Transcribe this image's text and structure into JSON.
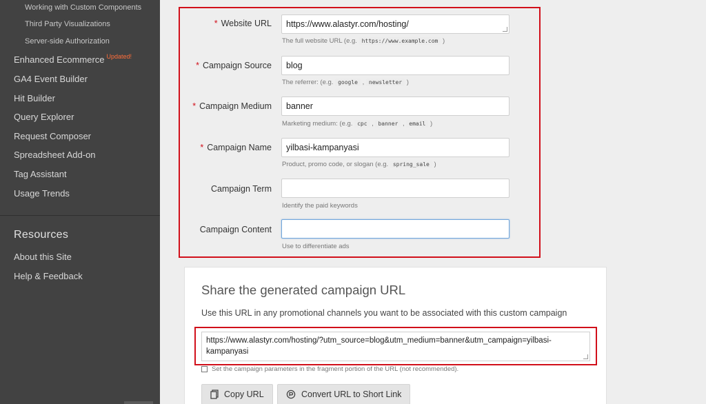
{
  "sidebar": {
    "sub_items": [
      "Working with Custom Components",
      "Third Party Visualizations",
      "Server-side Authorization"
    ],
    "items": [
      {
        "label": "Enhanced Ecommerce",
        "badge": "Updated!"
      },
      {
        "label": "GA4 Event Builder"
      },
      {
        "label": "Hit Builder"
      },
      {
        "label": "Query Explorer"
      },
      {
        "label": "Request Composer"
      },
      {
        "label": "Spreadsheet Add-on"
      },
      {
        "label": "Tag Assistant"
      },
      {
        "label": "Usage Trends"
      }
    ],
    "resources_title": "Resources",
    "resources": [
      "About this Site",
      "Help & Feedback"
    ]
  },
  "form": {
    "website_url": {
      "label": "Website URL",
      "value": "https://www.alastyr.com/hosting/",
      "help_prefix": "The full website URL (e.g.",
      "help_codes": [
        "https://www.example.com"
      ],
      "help_suffix": ")"
    },
    "campaign_source": {
      "label": "Campaign Source",
      "value": "blog",
      "help_prefix": "The referrer: (e.g.",
      "help_codes": [
        "google",
        "newsletter"
      ],
      "help_suffix": ")"
    },
    "campaign_medium": {
      "label": "Campaign Medium",
      "value": "banner",
      "help_prefix": "Marketing medium: (e.g.",
      "help_codes": [
        "cpc",
        "banner",
        "email"
      ],
      "help_suffix": ")"
    },
    "campaign_name": {
      "label": "Campaign Name",
      "value": "yilbasi-kampanyasi",
      "help_prefix": "Product, promo code, or slogan (e.g.",
      "help_codes": [
        "spring_sale"
      ],
      "help_suffix": ")"
    },
    "campaign_term": {
      "label": "Campaign Term",
      "value": "",
      "help": "Identify the paid keywords"
    },
    "campaign_content": {
      "label": "Campaign Content",
      "value": "",
      "help": "Use to differentiate ads"
    }
  },
  "share": {
    "title": "Share the generated campaign URL",
    "description": "Use this URL in any promotional channels you want to be associated with this custom campaign",
    "url": "https://www.alastyr.com/hosting/?utm_source=blog&utm_medium=banner&utm_campaign=yilbasi-kampanyasi",
    "fragment_checkbox_label": "Set the campaign parameters in the fragment portion of the URL (not recommended).",
    "copy_button": "Copy URL",
    "short_link_button": "Convert URL to Short Link"
  },
  "colors": {
    "highlight": "#d10f1a",
    "sidebar_bg": "#424242",
    "badge": "#ff6d3a"
  }
}
